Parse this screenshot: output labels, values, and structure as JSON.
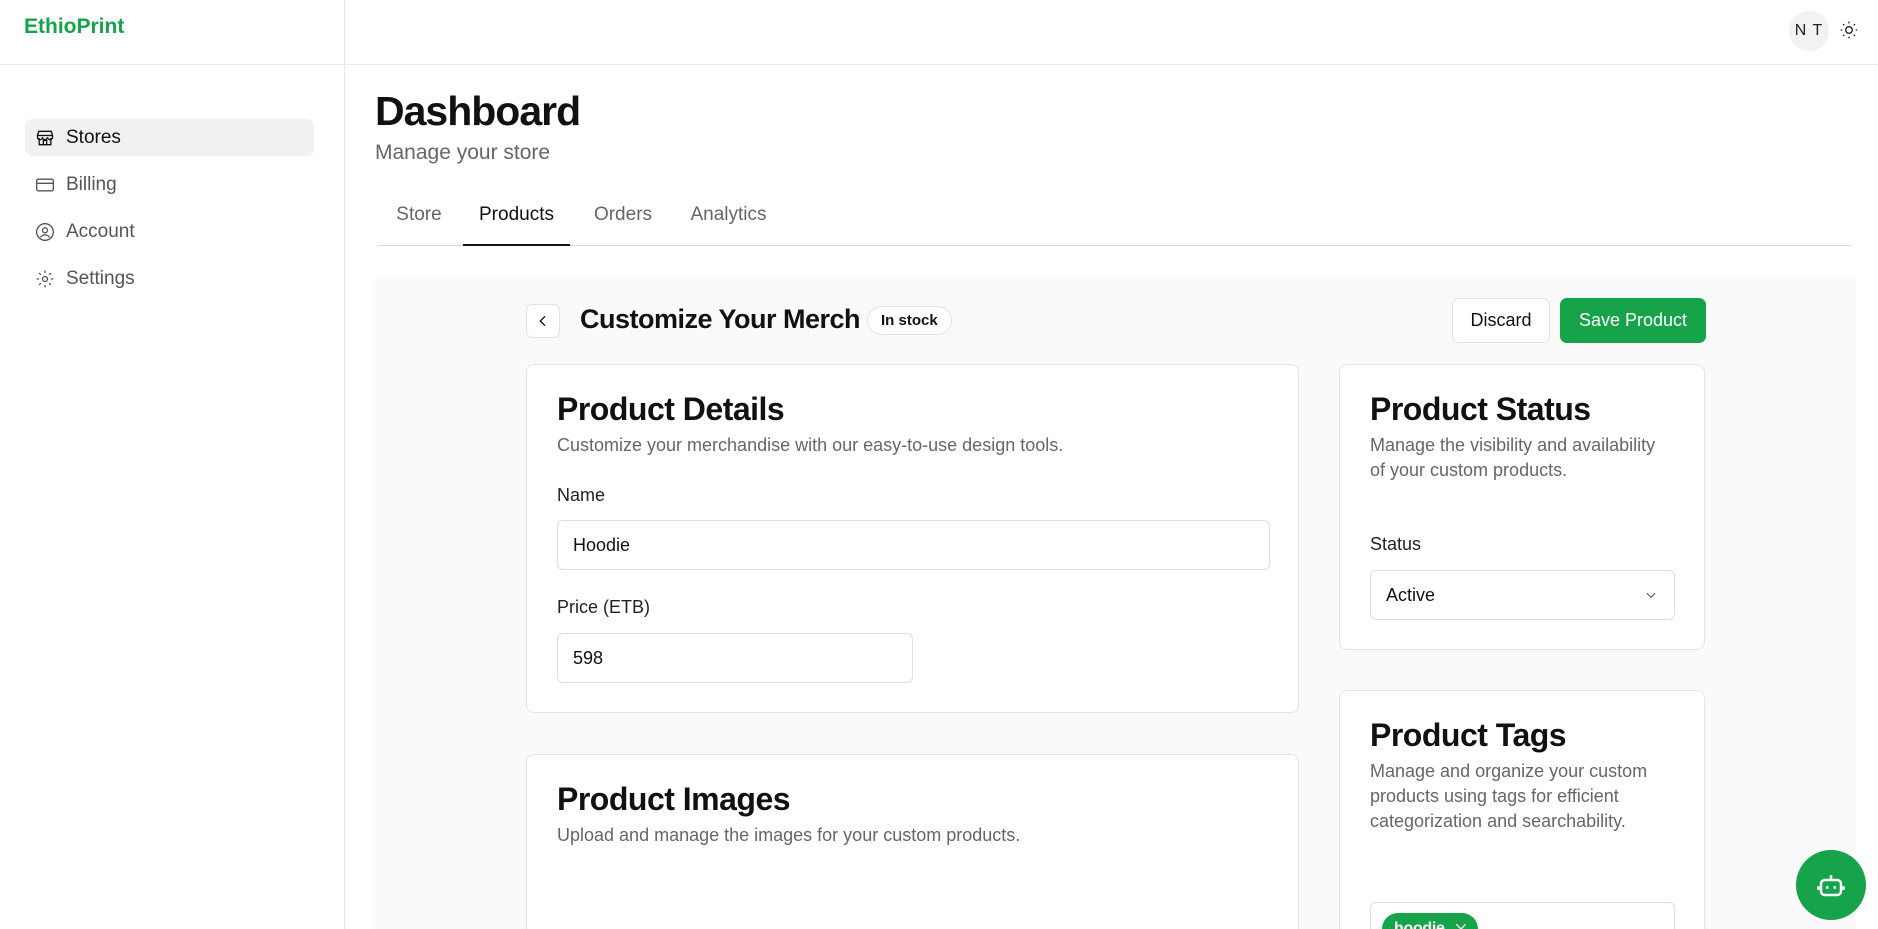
{
  "brand": {
    "name": "EthioPrint",
    "color": "#16a34a"
  },
  "sidebar": {
    "items": [
      {
        "label": "Stores",
        "icon": "store-icon",
        "active": true
      },
      {
        "label": "Billing",
        "icon": "credit-card-icon",
        "active": false
      },
      {
        "label": "Account",
        "icon": "user-circle-icon",
        "active": false
      },
      {
        "label": "Settings",
        "icon": "gear-icon",
        "active": false
      }
    ]
  },
  "header": {
    "avatar_initials": "N T",
    "theme_icon": "sun-icon"
  },
  "page": {
    "title": "Dashboard",
    "subtitle": "Manage your store"
  },
  "tabs": [
    {
      "label": "Store",
      "active": false
    },
    {
      "label": "Products",
      "active": true
    },
    {
      "label": "Orders",
      "active": false
    },
    {
      "label": "Analytics",
      "active": false
    }
  ],
  "product_header": {
    "title": "Customize Your Merch",
    "badge": "In stock",
    "discard_label": "Discard",
    "save_label": "Save Product"
  },
  "product_details": {
    "title": "Product Details",
    "description": "Customize your merchandise with our easy-to-use design tools.",
    "name_label": "Name",
    "name_value": "Hoodie",
    "price_label": "Price (ETB)",
    "price_value": "598"
  },
  "product_images": {
    "title": "Product Images",
    "description": "Upload and manage the images for your custom products."
  },
  "product_status": {
    "title": "Product Status",
    "description": "Manage the visibility and availability of your custom products.",
    "status_label": "Status",
    "status_value": "Active"
  },
  "product_tags": {
    "title": "Product Tags",
    "description": "Manage and organize your custom products using tags for efficient categorization and searchability.",
    "tags": [
      "hoodie"
    ]
  },
  "colors": {
    "accent": "#16a34a",
    "content_bg": "#fafafa"
  },
  "fab": {
    "icon": "bot-icon"
  }
}
